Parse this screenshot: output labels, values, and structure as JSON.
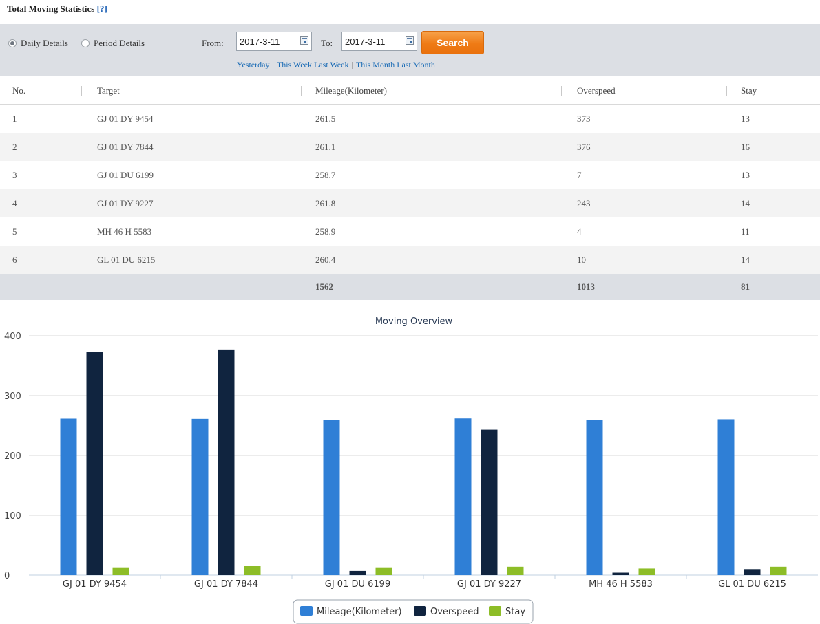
{
  "page": {
    "title": "Total Moving Statistics",
    "help": "[?]"
  },
  "filters": {
    "daily_label": "Daily Details",
    "period_label": "Period Details",
    "from_label": "From:",
    "to_label": "To:",
    "from_value": "2017-3-11",
    "to_value": "2017-3-11",
    "search_label": "Search",
    "quick_links": [
      "Yesterday",
      "This Week",
      "Last Week",
      "This Month",
      "Last Month"
    ]
  },
  "table": {
    "headers": [
      "No.",
      "Target",
      "Mileage(Kilometer)",
      "Overspeed",
      "Stay"
    ],
    "rows": [
      [
        "1",
        "GJ 01 DY 9454",
        "261.5",
        "373",
        "13"
      ],
      [
        "2",
        "GJ 01 DY 7844",
        "261.1",
        "376",
        "16"
      ],
      [
        "3",
        "GJ 01 DU 6199",
        "258.7",
        "7",
        "13"
      ],
      [
        "4",
        "GJ 01 DY 9227",
        "261.8",
        "243",
        "14"
      ],
      [
        "5",
        "MH 46 H 5583",
        "258.9",
        "4",
        "11"
      ],
      [
        "6",
        "GL 01 DU 6215",
        "260.4",
        "10",
        "14"
      ]
    ],
    "totals": [
      "",
      "",
      "1562",
      "1013",
      "81"
    ]
  },
  "colors": {
    "mileage": "#2f7fd6",
    "overspeed": "#10243f",
    "stay": "#8dbd27",
    "search": "#ef7b15"
  },
  "chart_data": {
    "type": "bar",
    "title": "Moving Overview",
    "categories": [
      "GJ 01 DY 9454",
      "GJ 01 DY 7844",
      "GJ 01 DU 6199",
      "GJ 01 DY 9227",
      "MH 46 H 5583",
      "GL 01 DU 6215"
    ],
    "series": [
      {
        "name": "Mileage(Kilometer)",
        "values": [
          261.5,
          261.1,
          258.7,
          261.8,
          258.9,
          260.4
        ]
      },
      {
        "name": "Overspeed",
        "values": [
          373,
          376,
          7,
          243,
          4,
          10
        ]
      },
      {
        "name": "Stay",
        "values": [
          13,
          16,
          13,
          14,
          11,
          14
        ]
      }
    ],
    "yticks": [
      0,
      100,
      200,
      300,
      400
    ],
    "ylim": [
      0,
      400
    ],
    "grid": true,
    "legend": "bottom-center"
  }
}
